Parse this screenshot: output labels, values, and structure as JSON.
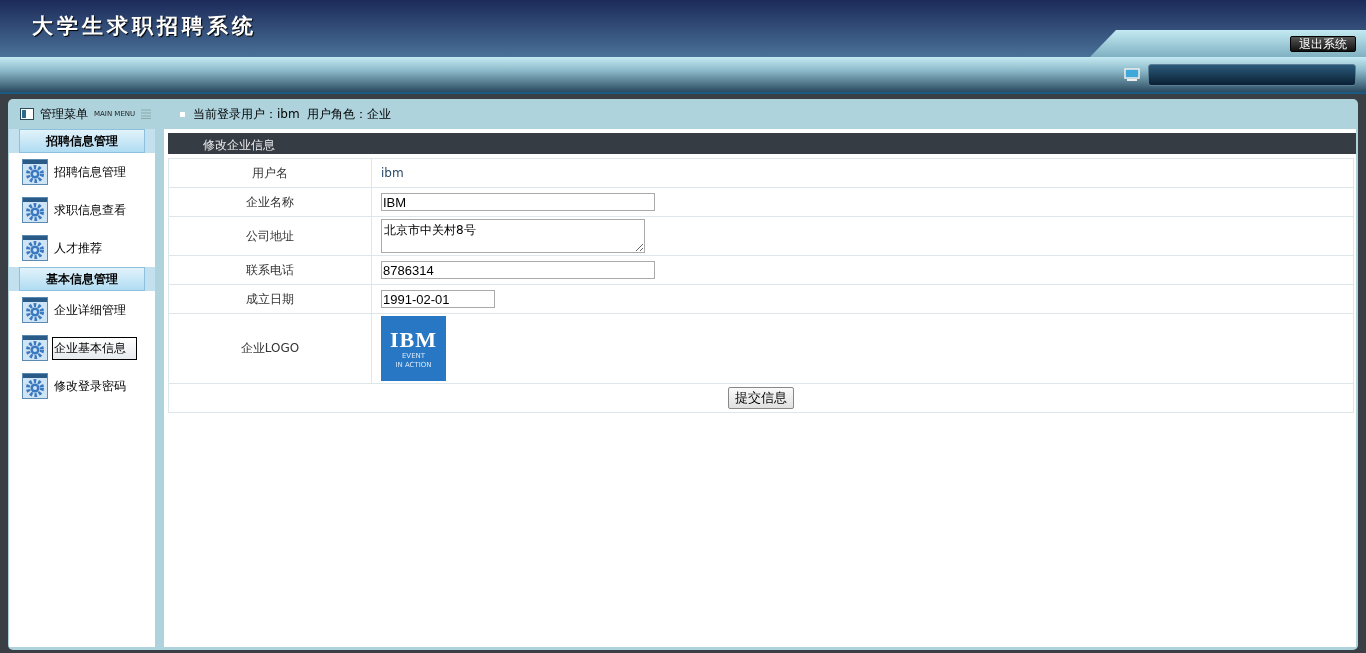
{
  "header": {
    "title": "大学生求职招聘系统",
    "logout_button": "退出系统"
  },
  "topbar": {
    "menu_title": "管理菜单",
    "menu_subtitle": "MAIN MENU",
    "current_user_label": "当前登录用户：",
    "current_user": "ibm",
    "role_label": "用户角色：",
    "role": "企业"
  },
  "sidebar": {
    "groups": [
      {
        "title": "招聘信息管理",
        "items": [
          {
            "label": "招聘信息管理",
            "selected": false
          },
          {
            "label": "求职信息查看",
            "selected": false
          },
          {
            "label": "人才推荐",
            "selected": false
          }
        ]
      },
      {
        "title": "基本信息管理",
        "items": [
          {
            "label": "企业详细管理",
            "selected": false
          },
          {
            "label": "企业基本信息",
            "selected": true
          },
          {
            "label": "修改登录密码",
            "selected": false
          }
        ]
      }
    ]
  },
  "form": {
    "title": "修改企业信息",
    "rows": [
      {
        "kind": "text",
        "label": "用户名",
        "value": "ibm"
      },
      {
        "kind": "input",
        "label": "企业名称",
        "value": "IBM"
      },
      {
        "kind": "textarea",
        "label": "公司地址",
        "value": "北京市中关村8号"
      },
      {
        "kind": "input",
        "label": "联系电话",
        "value": "8786314"
      },
      {
        "kind": "date",
        "label": "成立日期",
        "value": "1991-02-01"
      },
      {
        "kind": "logo",
        "label": "企业LOGO",
        "logo_text": "IBM",
        "logo_caption_1": "EVENT",
        "logo_caption_2": "IN ACTION"
      }
    ],
    "submit_button": "提交信息"
  }
}
